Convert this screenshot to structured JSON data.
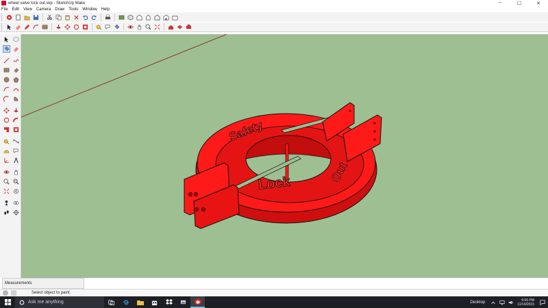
{
  "window": {
    "title": "wheel valve lock out.skp - SketchUp Make",
    "minimize_glyph": "─",
    "maximize_glyph": "☐",
    "close_glyph": "✕"
  },
  "menu": [
    "File",
    "Edit",
    "View",
    "Camera",
    "Draw",
    "Tools",
    "Window",
    "Help"
  ],
  "toolbar_top": [
    "getting-started-icon",
    "new-icon",
    "open-icon",
    "save-icon",
    "cut-icon",
    "copy-icon",
    "paste-icon",
    "erase-icon",
    "undo-icon",
    "redo-icon",
    "print-icon",
    "model-info-icon",
    "iso-view-icon",
    "top-view-icon",
    "front-view-icon",
    "right-view-icon",
    "back-view-icon",
    "left-view-icon"
  ],
  "toolbar_main": [
    "select-icon",
    "eraser-icon",
    "pencil-icon",
    "arc-icon",
    "rectangle-icon",
    "push-pull-icon",
    "move-icon",
    "rotate-icon",
    "offset-icon",
    "tape-measure-icon",
    "text-icon",
    "paint-bucket-icon",
    "orbit-icon",
    "pan-icon",
    "zoom-icon",
    "zoom-extents-icon",
    "warehouse-icon",
    "extension-icon",
    "components-icon"
  ],
  "scene": {
    "text_safety": "Safety",
    "text_lock": "Lock",
    "text_out": "Out",
    "model_color": "#ff1a1a",
    "viewport_color": "#9dbf92"
  },
  "measurements_label": "Measurements",
  "status_text": "Select object to paint.",
  "taskbar": {
    "search_placeholder": "Ask me anything",
    "desktop_label": "Desktop",
    "time": "6:00 PM",
    "date": "11/14/2015"
  }
}
